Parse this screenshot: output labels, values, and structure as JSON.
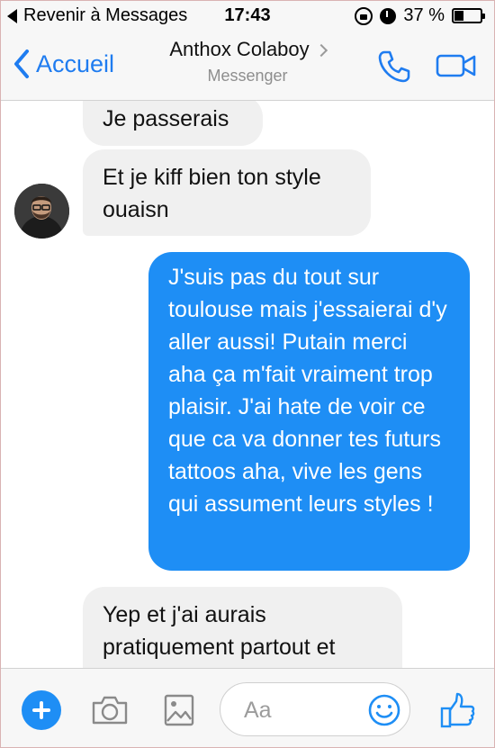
{
  "status_bar": {
    "back_label": "Revenir à Messages",
    "time": "17:43",
    "battery": "37 %",
    "battery_level": 0.37
  },
  "nav": {
    "back_label": "Accueil",
    "contact_name": "Anthox Colaboy",
    "subtitle": "Messenger",
    "accent_color": "#1f7cf0"
  },
  "messages": [
    {
      "side": "received",
      "text": "Je passerais"
    },
    {
      "side": "received",
      "text": "Et je kiff bien ton style ouaisn"
    },
    {
      "side": "sent",
      "text": "J'suis pas du tout sur toulouse mais j'essaierai d'y aller aussi! Putain merci aha ça m'fait vraiment trop plaisir. J'ai hate de voir ce que ca va donner tes futurs tattoos aha, vive les gens qui assument leurs styles !"
    },
    {
      "side": "received",
      "lines": [
        "Yep et j'ai aurais",
        "pratiquement partout et"
      ]
    }
  ],
  "composer": {
    "placeholder": "Aa",
    "icons": [
      "plus-icon",
      "camera-icon",
      "gallery-icon",
      "emoji-icon",
      "thumbs-up-icon"
    ]
  },
  "colors": {
    "sent_bubble": "#1e8ef5",
    "received_bubble": "#f0f0f0"
  }
}
